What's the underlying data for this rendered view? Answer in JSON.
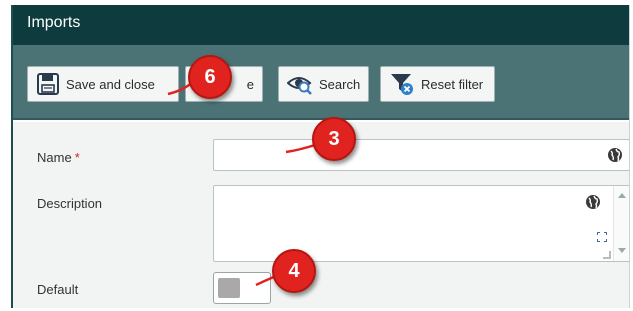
{
  "window": {
    "title": "Imports"
  },
  "toolbar": {
    "save_close_label": "Save and close",
    "second_label": "e",
    "search_label": "Search",
    "reset_filter_label": "Reset filter"
  },
  "form": {
    "name_label": "Name",
    "required_marker": "*",
    "name_value": "",
    "description_label": "Description",
    "description_value": "",
    "default_label": "Default",
    "default_enabled": false
  },
  "callouts": [
    "6",
    "3",
    "4"
  ],
  "icons": {
    "save": "floppy-disk-icon",
    "search": "eye-search-icon",
    "reset": "funnel-clear-icon",
    "globe": "globe-icon",
    "expand": "expand-icon"
  },
  "colors": {
    "titlebar": "#0d3b3e",
    "toolbar": "#4b7375",
    "callout": "#e0231f",
    "required": "#d0222b"
  }
}
